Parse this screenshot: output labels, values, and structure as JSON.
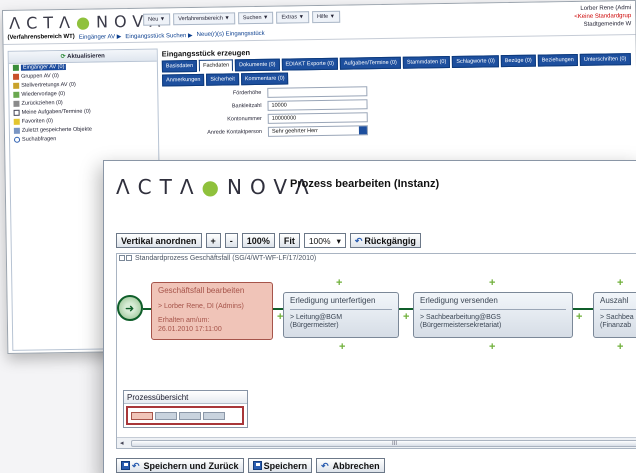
{
  "background": {
    "logo_text": "ΛCTΛ",
    "logo_dot": "●",
    "logo_text_end": "NOVΛ",
    "menus": [
      "Neu ▼",
      "Verfahrensbereich ▼",
      "Suchen ▼",
      "Extras ▼",
      "Hilfe ▼"
    ],
    "user": {
      "name": "Lorber Rene (Admi",
      "default_group": "<Keine Standardgrup",
      "org": "Stadtgemeinde W"
    },
    "breadcrumb": {
      "area": "(Verfahrensbereich WT)",
      "item1": "Eingänger AV ▶",
      "item2": "Eingangsstück Suchen ▶",
      "item3": "Neue(r)(s) Eingangsstück"
    },
    "tree": {
      "refresh_label": "Aktualisieren",
      "items": [
        "Eingänger AV (0)",
        "Gruppen AV (0)",
        "Stellvertretungs AV (0)",
        "Wiedervorlage (0)",
        "Zurückziehen (0)",
        "Meine Aufgaben/Termine (0)",
        "Favoriten (0)",
        "Zuletzt gespeicherte Objekte",
        "Suchabfragen"
      ]
    },
    "form": {
      "title": "Eingangsstück erzeugen",
      "tabs": [
        "Basisdaten",
        "Fachdaten",
        "Dokumente (0)",
        "EDIAKT Exporte (0)",
        "Aufgaben/Termine (0)",
        "Stammdaten (0)",
        "Schlagworte (0)",
        "Bezüge (0)",
        "Beziehungen",
        "Unterschriften (0)",
        "Anmerkungen",
        "Sicherheit",
        "Kommentare (0)"
      ],
      "active_tab": "Fachdaten",
      "rows": [
        {
          "label": "Förderhöhe",
          "value": ""
        },
        {
          "label": "Bankleitzahl",
          "value": "10000"
        },
        {
          "label": "Kontonummer",
          "value": "10000000"
        },
        {
          "label": "Anrede Kontaktperson",
          "value": "Sehr geehrter Herr"
        }
      ]
    }
  },
  "dialog": {
    "logo_text": "ΛCTΛ",
    "logo_dot": "●",
    "logo_text_end": "NOVΛ",
    "title": "Prozess bearbeiten (Instanz)",
    "toolbar": {
      "vertical_label": "Vertikal anordnen",
      "zoom_in_label": "+",
      "zoom_out_label": "-",
      "zoom_100_label": "100%",
      "fit_label": "Fit",
      "zoom_select_value": "100%",
      "zoom_select_arrow": "▾",
      "undo_label": "Rückgängig",
      "undo_glyph": "↶"
    },
    "process_title": "Standardprozess Geschäftsfall (SG/4/WT-WF-LF/17/2010)",
    "nodes": [
      {
        "title": "Geschäftsfall bearbeiten",
        "line1": "> Lorber Rene, DI (Admins)",
        "line2": "Erhalten am/um:",
        "line3": "26.01.2010 17:11:00",
        "state": "active"
      },
      {
        "title": "Erledigung unterfertigen",
        "line1": "> Leitung@BGM",
        "line2": "(Bürgermeister)",
        "state": "pending"
      },
      {
        "title": "Erledigung versenden",
        "line1": "> Sachbearbeitung@BGS",
        "line2": "(Bürgermeistersekretariat)",
        "state": "pending"
      },
      {
        "title": "Auszahl",
        "line1": "> Sachbea",
        "line2": "(Finanzab",
        "state": "pending"
      }
    ],
    "plus_glyph": "+",
    "overview_title": "Prozessübersicht",
    "scroll_left": "◂",
    "scroll_grip": "III",
    "footer": {
      "save_close_label": "Speichern und Zurück",
      "save_label": "Speichern",
      "cancel_label": "Abbrechen"
    }
  }
}
